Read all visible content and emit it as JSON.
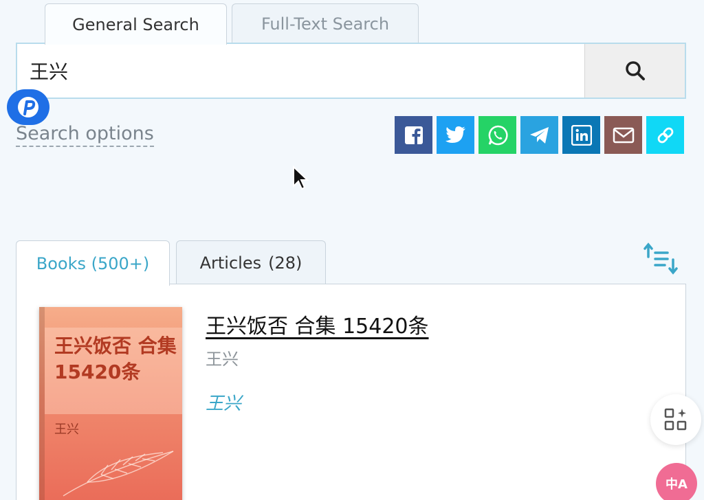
{
  "search_tabs": {
    "general": "General Search",
    "full_text": "Full-Text Search"
  },
  "search": {
    "value": "王兴",
    "button_icon": "search-icon"
  },
  "search_options_label": "Search options",
  "share_buttons": [
    {
      "name": "facebook",
      "color": "#3b5998"
    },
    {
      "name": "twitter",
      "color": "#1da1f2"
    },
    {
      "name": "whatsapp",
      "color": "#25d366"
    },
    {
      "name": "telegram",
      "color": "#2aa3e0"
    },
    {
      "name": "linkedin",
      "color": "#0a77b5"
    },
    {
      "name": "email",
      "color": "#8a5a55"
    },
    {
      "name": "link",
      "color": "#10d8f6"
    }
  ],
  "result_tabs": {
    "books_label": "Books (500+)",
    "articles_label": "Articles",
    "articles_count": "(28)"
  },
  "book": {
    "title": "王兴饭否 合集 15420条",
    "author": "王兴",
    "author_link": "王兴",
    "cover_title": "王兴饭否 合集 15420条",
    "cover_author": "王兴"
  },
  "floating": {
    "apps_icon": "apps-sparkle-icon",
    "translate_icon": "translate-icon",
    "translate_text": "中A"
  },
  "colors": {
    "accent": "#3aa6c8",
    "badge_blue": "#1f6fe6",
    "translate_pink": "#f06c94"
  }
}
